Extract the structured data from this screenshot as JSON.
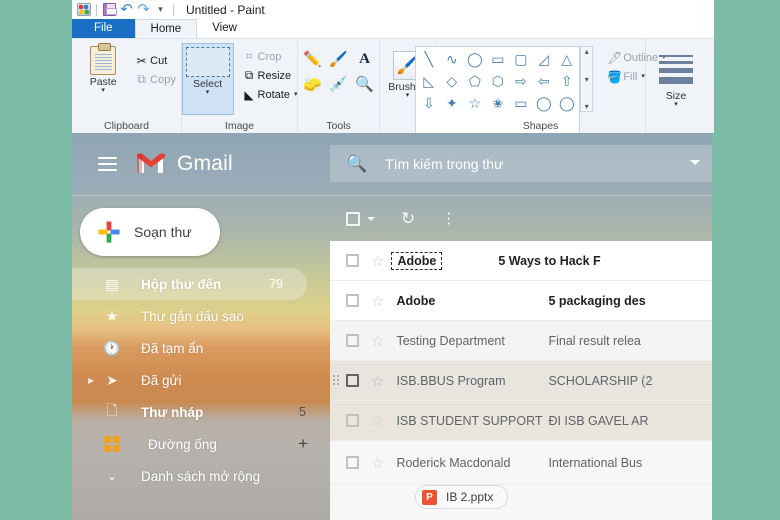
{
  "desktop": {
    "background_color": "#7dbca6"
  },
  "paint": {
    "title": "Untitled - Paint",
    "quick_access": [
      {
        "name": "paint-logo-icon",
        "label": "Paint"
      },
      {
        "name": "save-icon",
        "label": "Save"
      },
      {
        "name": "undo-icon",
        "label": "Undo",
        "glyph": "↶"
      },
      {
        "name": "redo-icon",
        "label": "Redo",
        "glyph": "↷"
      },
      {
        "name": "customize-quick-access-icon",
        "label": "Customize",
        "glyph": "▾"
      }
    ],
    "tabs": [
      {
        "label": "File",
        "active": false,
        "style": "file"
      },
      {
        "label": "Home",
        "active": true
      },
      {
        "label": "View",
        "active": false
      }
    ],
    "ribbon": {
      "clipboard": {
        "group_label": "Clipboard",
        "paste_label": "Paste",
        "cut_label": "Cut",
        "copy_label": "Copy"
      },
      "image": {
        "group_label": "Image",
        "select_label": "Select",
        "crop_label": "Crop",
        "resize_label": "Resize",
        "rotate_label": "Rotate"
      },
      "tools": {
        "group_label": "Tools",
        "items": [
          {
            "name": "pencil-icon",
            "glyph": "✏"
          },
          {
            "name": "fill-with-color-icon",
            "glyph": "🪣"
          },
          {
            "name": "text-tool-icon",
            "glyph": "A"
          },
          {
            "name": "eraser-icon",
            "glyph": "▭"
          },
          {
            "name": "color-picker-icon",
            "glyph": "💉"
          },
          {
            "name": "magnifier-icon",
            "glyph": "🔍"
          }
        ]
      },
      "brushes": {
        "label": "Brushes"
      },
      "shapes": {
        "group_label": "Shapes",
        "outline_label": "Outline",
        "fill_label": "Fill",
        "glyphs": [
          "╲",
          "∿",
          "◯",
          "▭",
          "▢",
          "◿",
          "△",
          "◺",
          "◇",
          "⬠",
          "⬡",
          "⇨",
          "⇦",
          "⇧",
          "⇩",
          "✦",
          "☆",
          "✬",
          "▭",
          "◯",
          "◯"
        ]
      },
      "size": {
        "label": "Size"
      }
    }
  },
  "gmail": {
    "brand": "Gmail",
    "search": {
      "placeholder": "Tìm kiếm trong thư"
    },
    "compose": {
      "label": "Soạn thư"
    },
    "sidebar": [
      {
        "label": "Hộp thư đến",
        "count": "79",
        "icon": "inbox-icon",
        "glyph": "▤",
        "active": true,
        "bold": true
      },
      {
        "label": "Thư gắn dấu sao",
        "count": "",
        "icon": "star-icon",
        "glyph": "★",
        "active": false,
        "bold": false
      },
      {
        "label": "Đã tạm ẩn",
        "count": "",
        "icon": "snoozed-clock-icon",
        "glyph": "🕐",
        "active": false,
        "bold": false
      },
      {
        "label": "Đã gửi",
        "count": "",
        "icon": "sent-icon",
        "glyph": "➤",
        "active": false,
        "bold": false
      },
      {
        "label": "Thư nháp",
        "count": "5",
        "icon": "drafts-icon",
        "glyph": "🗋",
        "active": false,
        "bold": true
      },
      {
        "label": "Đường ống",
        "count": "",
        "icon": "meet-grid-icon",
        "glyph": "",
        "active": false,
        "bold": false
      },
      {
        "label": "Danh sách mở rộng",
        "count": "",
        "icon": "chevron-down-icon",
        "glyph": "⌄",
        "active": false,
        "bold": false
      }
    ],
    "list_toolbar": {
      "select_all": "select-all-checkbox",
      "refresh": "↻",
      "more": "⋮"
    },
    "emails": [
      {
        "sender": "Adobe",
        "subject": "5 Ways to Hack F",
        "unread": true,
        "selected": true,
        "hover": false
      },
      {
        "sender": "Adobe",
        "subject": "5 packaging des",
        "unread": true,
        "selected": false,
        "hover": false
      },
      {
        "sender": "Testing Department",
        "subject": "Final result relea",
        "unread": false,
        "selected": false,
        "hover": false
      },
      {
        "sender": "ISB.BBUS Program",
        "subject": "SCHOLARSHIP (2",
        "unread": false,
        "selected": false,
        "hover": true
      },
      {
        "sender": "ISB STUDENT SUPPORT",
        "subject": "ĐI ISB GAVEL AR",
        "unread": false,
        "selected": false,
        "hover": true
      },
      {
        "sender": "Roderick Macdonald",
        "subject": "International Bus",
        "unread": false,
        "selected": false,
        "hover": false
      }
    ],
    "attachment": {
      "name": "IB 2.pptx",
      "type_badge": "P",
      "badge_color": "#e8542f"
    }
  }
}
